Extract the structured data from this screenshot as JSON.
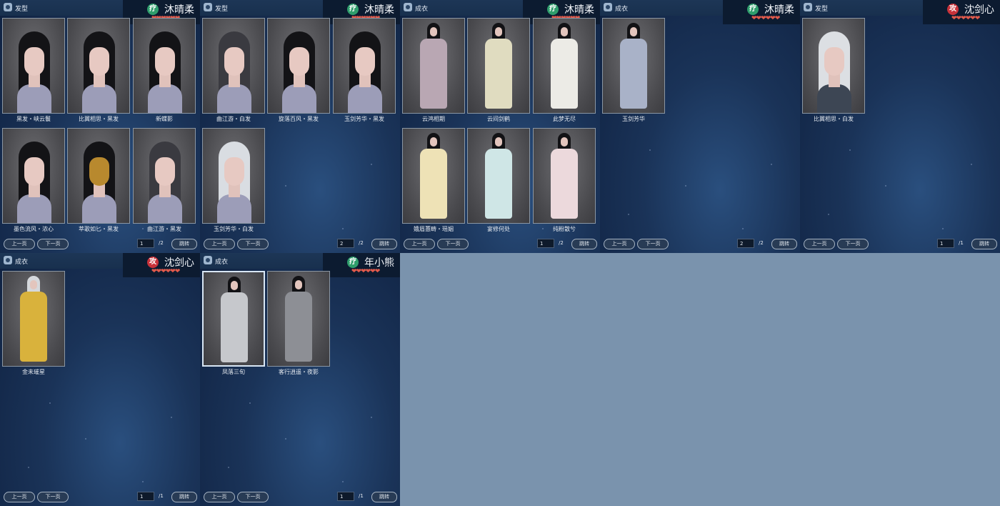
{
  "colors": {
    "heal": "#2f9e6c",
    "attack": "#c8323a",
    "hearts": "#e05a4c",
    "background": "#7a93ad"
  },
  "pager_labels": {
    "prev": "上一页",
    "next": "下一页",
    "jump": "跳转"
  },
  "panels": [
    {
      "category": "发型",
      "character": {
        "name": "沐晴柔",
        "role": "疗",
        "role_color": "#2f9e6c"
      },
      "hearts": "❤❤❤❤❤❤",
      "items": [
        {
          "label": "黑发・峡云鬟"
        },
        {
          "label": "比翼相思・黑发"
        },
        {
          "label": "新蝶影"
        },
        {
          "label": "墨色流风・浓心"
        },
        {
          "label": "萃歌如匕・黑发"
        },
        {
          "label": "曲江游・黑发"
        }
      ],
      "page": "1",
      "total": "/2"
    },
    {
      "category": "发型",
      "character": {
        "name": "沐晴柔",
        "role": "疗",
        "role_color": "#2f9e6c"
      },
      "hearts": "❤❤❤❤❤❤",
      "items": [
        {
          "label": "曲江游・白发"
        },
        {
          "label": "旋落百风・黑发"
        },
        {
          "label": "玉剑芳华・黑发"
        },
        {
          "label": "玉剑芳华・白发"
        }
      ],
      "page": "2",
      "total": "/2"
    },
    {
      "category": "成衣",
      "character": {
        "name": "沐晴柔",
        "role": "疗",
        "role_color": "#2f9e6c"
      },
      "hearts": "❤❤❤❤❤❤",
      "items": [
        {
          "label": "云鸿相期"
        },
        {
          "label": "云间剑鹤"
        },
        {
          "label": "此梦无尽"
        },
        {
          "label": "娥眉蕙畴・瑶姻"
        },
        {
          "label": "宴修何处"
        },
        {
          "label": "纯粉散兮"
        }
      ],
      "page": "1",
      "total": "/2"
    },
    {
      "category": "成衣",
      "character": {
        "name": "沐晴柔",
        "role": "疗",
        "role_color": "#2f9e6c"
      },
      "hearts": "❤❤❤❤❤❤",
      "items": [
        {
          "label": "玉剑芳华"
        }
      ],
      "page": "2",
      "total": "/2"
    },
    {
      "category": "发型",
      "character": {
        "name": "沈剑心",
        "role": "攻",
        "role_color": "#c8323a"
      },
      "hearts": "❤❤❤❤❤❤",
      "items": [
        {
          "label": "比翼相思・白发"
        }
      ],
      "page": "1",
      "total": "/1"
    },
    {
      "category": "成衣",
      "character": {
        "name": "沈剑心",
        "role": "攻",
        "role_color": "#c8323a"
      },
      "hearts": "❤❤❤❤❤❤",
      "items": [
        {
          "label": "金未璀星"
        }
      ],
      "page": "1",
      "total": "/1"
    },
    {
      "category": "成衣",
      "character": {
        "name": "年小熊",
        "role": "疗",
        "role_color": "#2f9e6c"
      },
      "hearts": "❤❤❤❤❤❤",
      "items": [
        {
          "label": "凤落三旬"
        },
        {
          "label": "客行逍遥・夜影"
        }
      ],
      "page": "1",
      "total": "/1"
    }
  ]
}
